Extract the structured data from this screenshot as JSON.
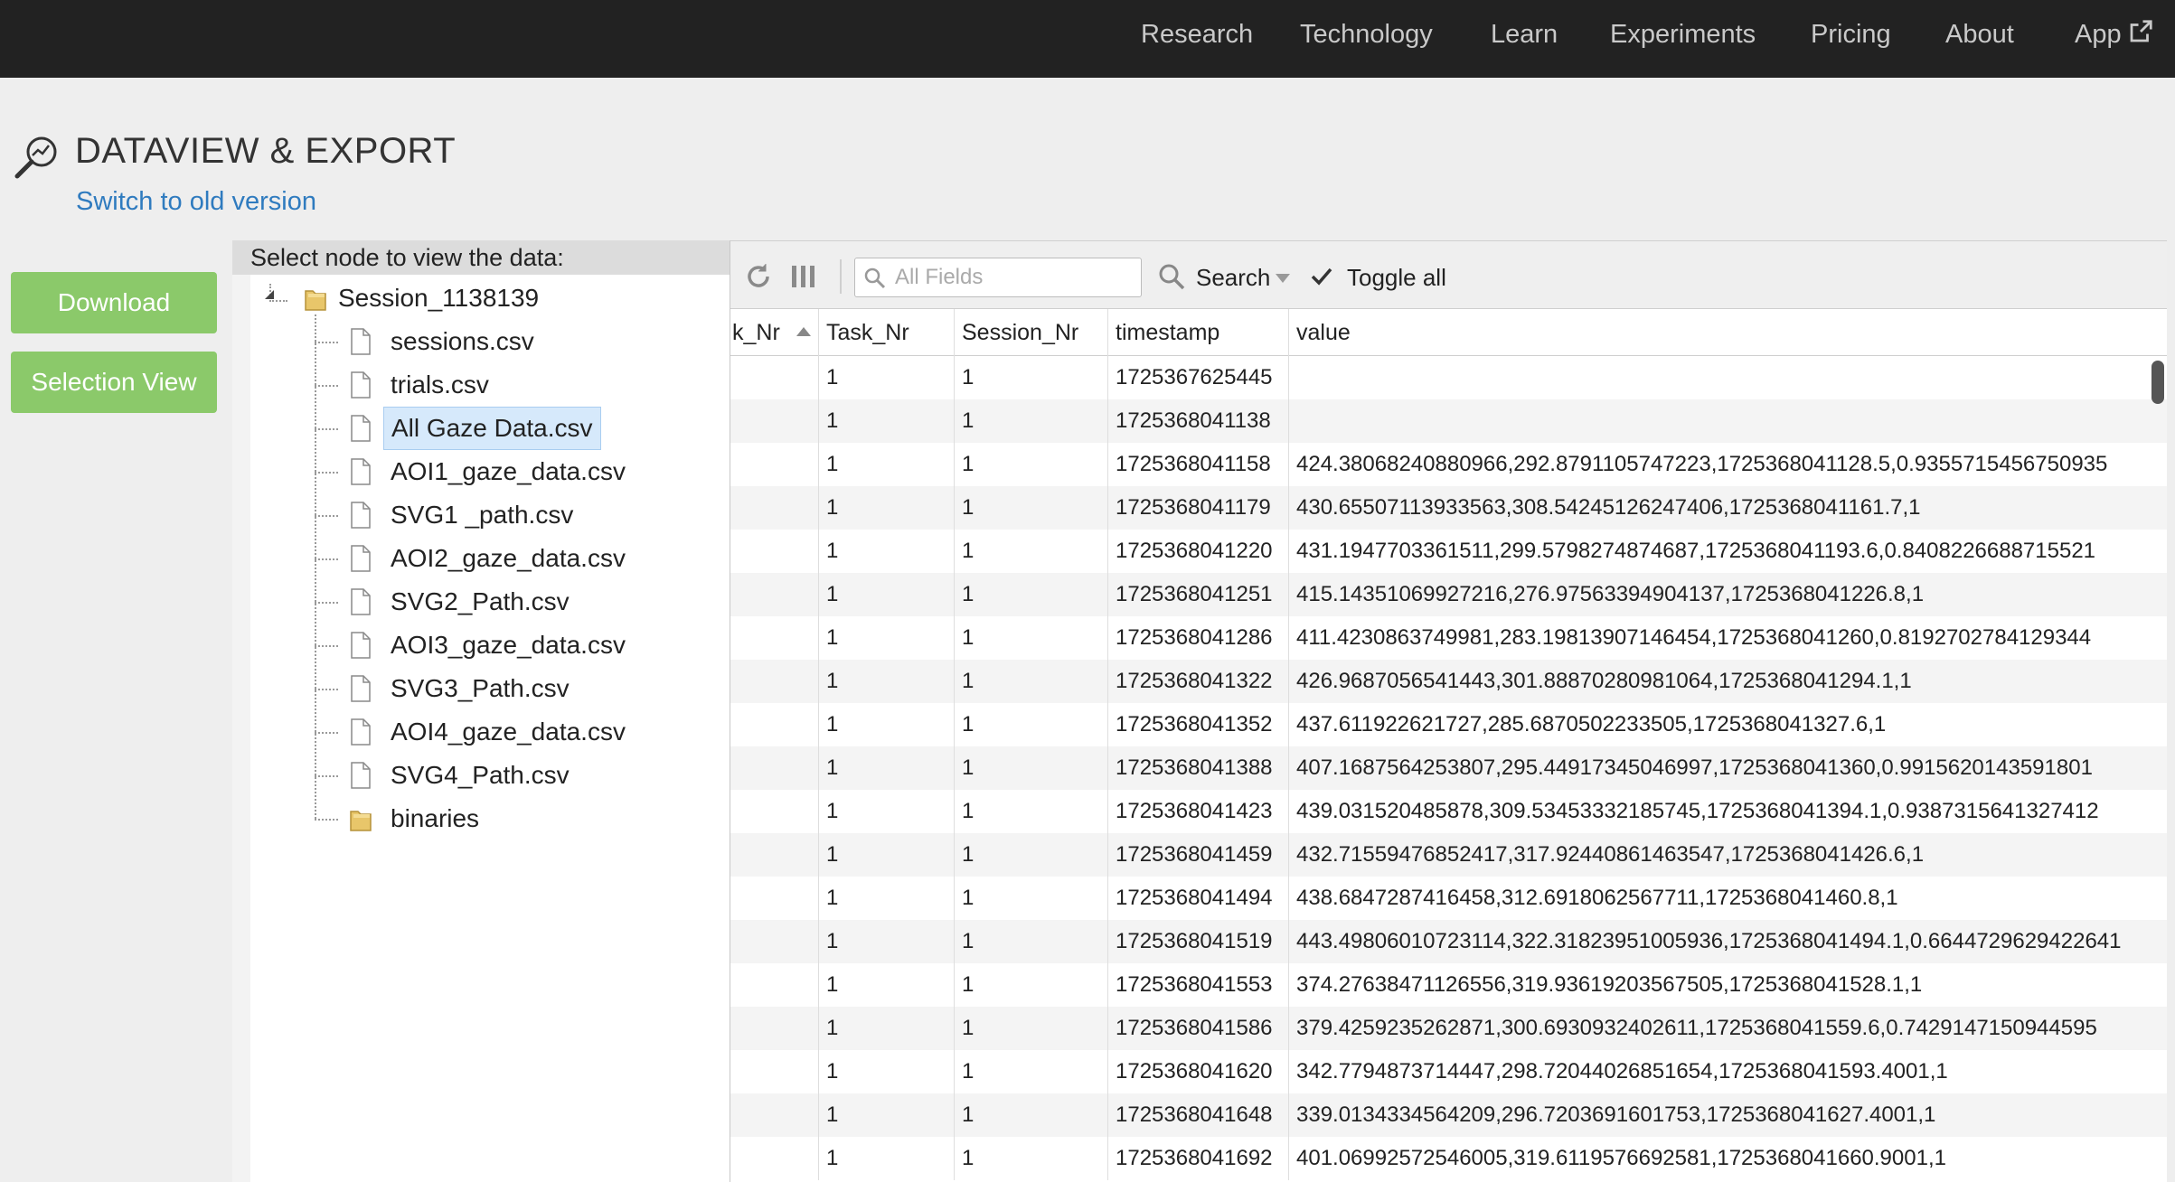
{
  "nav": {
    "items": [
      "Research",
      "Technology",
      "Learn",
      "Experiments",
      "Pricing",
      "About",
      "App"
    ]
  },
  "header": {
    "title": "DATAVIEW & EXPORT",
    "old_version_link": "Switch to old version"
  },
  "actions": {
    "download": "Download",
    "selection_view": "Selection View"
  },
  "tree": {
    "header": "Select node to view the data:",
    "root": "Session_1138139",
    "files": [
      "sessions.csv",
      "trials.csv",
      "All Gaze Data.csv",
      "AOI1_gaze_data.csv",
      "SVG1 _path.csv",
      "AOI2_gaze_data.csv",
      "SVG2_Path.csv",
      "AOI3_gaze_data.csv",
      "SVG3_Path.csv",
      "AOI4_gaze_data.csv",
      "SVG4_Path.csv"
    ],
    "folder": "binaries",
    "selected": "All Gaze Data.csv"
  },
  "toolbar": {
    "search_placeholder": "All Fields",
    "search_label": "Search",
    "toggle_all": "Toggle all"
  },
  "columns": [
    "k_Nr",
    "Task_Nr",
    "Session_Nr",
    "timestamp",
    "value"
  ],
  "rows": [
    [
      "",
      "1",
      "1",
      "1725367625445",
      ""
    ],
    [
      "",
      "1",
      "1",
      "1725368041138",
      ""
    ],
    [
      "",
      "1",
      "1",
      "1725368041158",
      "424.38068240880966,292.8791105747223,1725368041128.5,0.9355715456750935"
    ],
    [
      "",
      "1",
      "1",
      "1725368041179",
      "430.65507113933563,308.54245126247406,1725368041161.7,1"
    ],
    [
      "",
      "1",
      "1",
      "1725368041220",
      "431.1947703361511,299.5798274874687,1725368041193.6,0.8408226688715521"
    ],
    [
      "",
      "1",
      "1",
      "1725368041251",
      "415.14351069927216,276.97563394904137,1725368041226.8,1"
    ],
    [
      "",
      "1",
      "1",
      "1725368041286",
      "411.4230863749981,283.19813907146454,1725368041260,0.8192702784129344"
    ],
    [
      "",
      "1",
      "1",
      "1725368041322",
      "426.9687056541443,301.88870280981064,1725368041294.1,1"
    ],
    [
      "",
      "1",
      "1",
      "1725368041352",
      "437.611922621727,285.6870502233505,1725368041327.6,1"
    ],
    [
      "",
      "1",
      "1",
      "1725368041388",
      "407.1687564253807,295.44917345046997,1725368041360,0.9915620143591801"
    ],
    [
      "",
      "1",
      "1",
      "1725368041423",
      "439.031520485878,309.53453332185745,1725368041394.1,0.9387315641327412"
    ],
    [
      "",
      "1",
      "1",
      "1725368041459",
      "432.71559476852417,317.92440861463547,1725368041426.6,1"
    ],
    [
      "",
      "1",
      "1",
      "1725368041494",
      "438.6847287416458,312.6918062567711,1725368041460.8,1"
    ],
    [
      "",
      "1",
      "1",
      "1725368041519",
      "443.49806010723114,322.31823951005936,1725368041494.1,0.6644729629422641"
    ],
    [
      "",
      "1",
      "1",
      "1725368041553",
      "374.27638471126556,319.93619203567505,1725368041528.1,1"
    ],
    [
      "",
      "1",
      "1",
      "1725368041586",
      "379.4259235262871,300.6930932402611,1725368041559.6,0.7429147150944595"
    ],
    [
      "",
      "1",
      "1",
      "1725368041620",
      "342.7794873714447,298.72044026851654,1725368041593.4001,1"
    ],
    [
      "",
      "1",
      "1",
      "1725368041648",
      "339.0134334564209,296.7203691601753,1725368041627.4001,1"
    ],
    [
      "",
      "1",
      "1",
      "1725368041692",
      "401.06992572546005,319.6119576692581,1725368041660.9001,1"
    ]
  ],
  "icons": {
    "page": "magnifier-graph-icon",
    "refresh": "refresh-icon",
    "columns": "columns-icon",
    "search": "search-icon",
    "check": "check-icon",
    "file": "file-icon",
    "folder": "folder-icon",
    "external": "external-link-icon"
  },
  "colors": {
    "nav_bg": "#222222",
    "accent_green": "#8bc96a",
    "link_blue": "#2f7bbf",
    "selected_bg": "#d6e9fb"
  }
}
